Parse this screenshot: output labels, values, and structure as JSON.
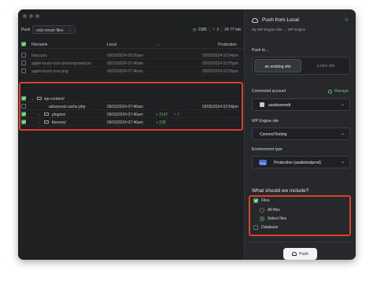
{
  "toolbar": {
    "push_label": "Push",
    "filter_value": "only newer files",
    "sync_count": "2385",
    "delete_count": "2",
    "size": "24.77 mb"
  },
  "table": {
    "headers": {
      "filename": "Filename",
      "local": "Local",
      "arrow": "→",
      "production": "Production"
    },
    "rows": [
      {
        "name": "htaccess",
        "local": "09/16/2024 09:20am",
        "prod": "03/05/2024 02:54pm"
      },
      {
        "name": "apple-touch-icon-precomposed.pn",
        "local": "09/23/2024 07:46am",
        "prod": "03/05/2024 02:55pm"
      },
      {
        "name": "apple-touch-icon.png",
        "local": "09/23/2024 07:46am",
        "prod": "03/05/2024 02:55pm"
      },
      {
        "name": "wp-content/",
        "local": "",
        "prod": ""
      },
      {
        "name": "advanced-cache.php",
        "local": "09/23/2024 07:46am",
        "prod": "03/05/2024 02:54pm"
      },
      {
        "name": "plugins/",
        "local": "09/23/2024 07:46am",
        "added": "+ 2147",
        "removed": "× 2"
      },
      {
        "name": "themes/",
        "local": "09/23/2024 07:46am",
        "added": "+ 238"
      }
    ]
  },
  "panel": {
    "title": "Push from Local",
    "crumb_from": "My WP Engine Site",
    "crumb_arrow": "→",
    "crumb_to": "WP Engine",
    "push_to_label": "Push to...",
    "option_existing": "an existing site",
    "option_new": "a new site",
    "connected_account_label": "Connected account",
    "manage_label": "Manage",
    "account_value": "austinwerndt",
    "wpe_site_label": "WP Engine site",
    "site_value": "ConnectTesting",
    "env_type_label": "Environment type",
    "env_badge": "Prd",
    "env_value": "Production (austintestprod)",
    "include_title": "What should we include?",
    "files_label": "Files",
    "all_files_label": "All files",
    "select_files_label": "Select files",
    "database_label": "Database",
    "push_button": "Push"
  },
  "colors": {
    "accent_green": "#3fa34d",
    "highlight_red": "#d9432b",
    "badge_blue": "#4a6fd1"
  }
}
